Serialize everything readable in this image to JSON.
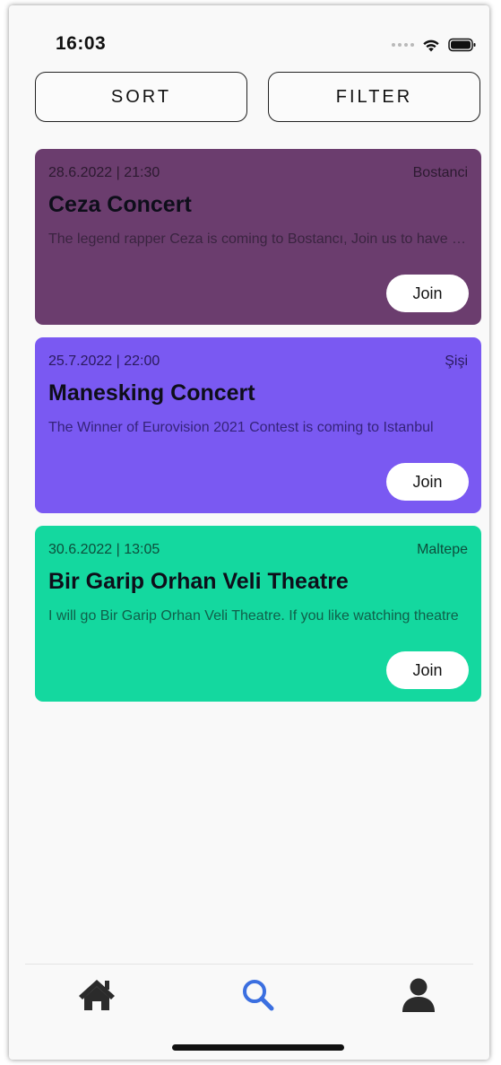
{
  "status_bar": {
    "time": "16:03",
    "icons": [
      "signal-icon",
      "wifi-icon",
      "battery-icon"
    ]
  },
  "toolbar": {
    "sort_label": "SORT",
    "filter_label": "FILTER"
  },
  "events": [
    {
      "date": "28.6.2022 | 21:30",
      "place": "Bostanci",
      "title": "Ceza Concert",
      "description": "The legend rapper Ceza is coming to Bostancı, Join us to have fun",
      "join_label": "Join",
      "color": "#6b3d6e"
    },
    {
      "date": "25.7.2022 | 22:00",
      "place": "Şişi",
      "title": "Manesking Concert",
      "description": "The Winner of Eurovision 2021 Contest is coming to Istanbul",
      "join_label": "Join",
      "color": "#7a59f2"
    },
    {
      "date": "30.6.2022 | 13:05",
      "place": "Maltepe",
      "title": "Bir Garip Orhan Veli Theatre",
      "description": "I will go Bir Garip Orhan Veli Theatre. If you like watching theatre",
      "join_label": "Join",
      "color": "#14d89f"
    }
  ],
  "tab_bar": {
    "items": [
      "home-icon",
      "search-icon",
      "profile-icon"
    ],
    "active_color": "#3b6fe0",
    "inactive_color": "#2b2b2b"
  }
}
